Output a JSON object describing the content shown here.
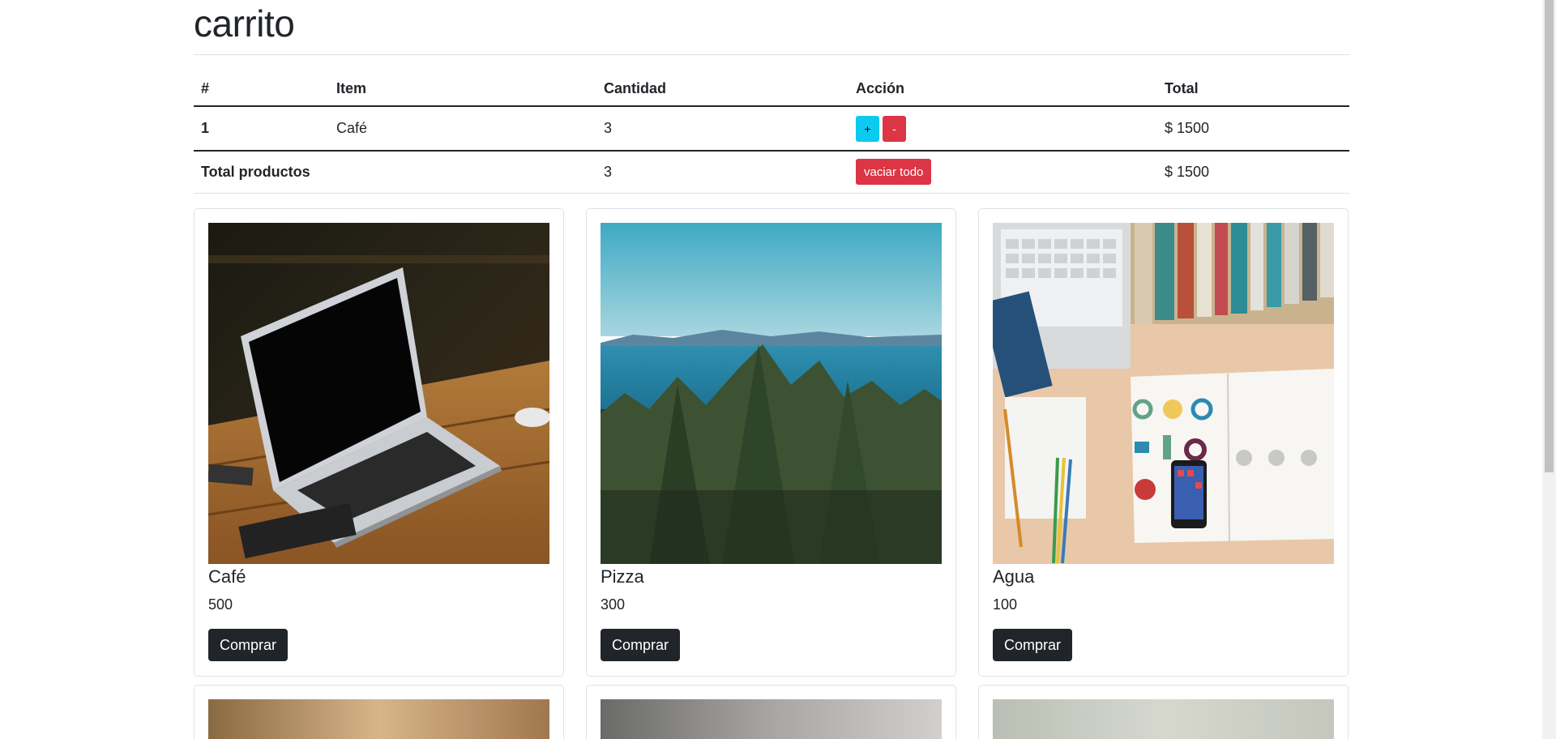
{
  "page": {
    "title": "carrito"
  },
  "cart": {
    "headers": [
      "#",
      "Item",
      "Cantidad",
      "Acción",
      "Total"
    ],
    "rows": [
      {
        "index": "1",
        "item": "Café",
        "quantity": "3",
        "plus_label": "+",
        "minus_label": "-",
        "total": "$ 1500"
      }
    ],
    "footer": {
      "label": "Total productos",
      "quantity": "3",
      "empty_label": "vaciar todo",
      "total": "$ 1500"
    }
  },
  "products": [
    {
      "name": "Café",
      "price": "500",
      "buy_label": "Comprar",
      "image": "laptop-photo"
    },
    {
      "name": "Pizza",
      "price": "300",
      "buy_label": "Comprar",
      "image": "forest-sea-photo"
    },
    {
      "name": "Agua",
      "price": "100",
      "buy_label": "Comprar",
      "image": "desk-books-photo"
    }
  ],
  "colors": {
    "info": "#0dcaf0",
    "danger": "#dc3545",
    "dark": "#212529"
  }
}
